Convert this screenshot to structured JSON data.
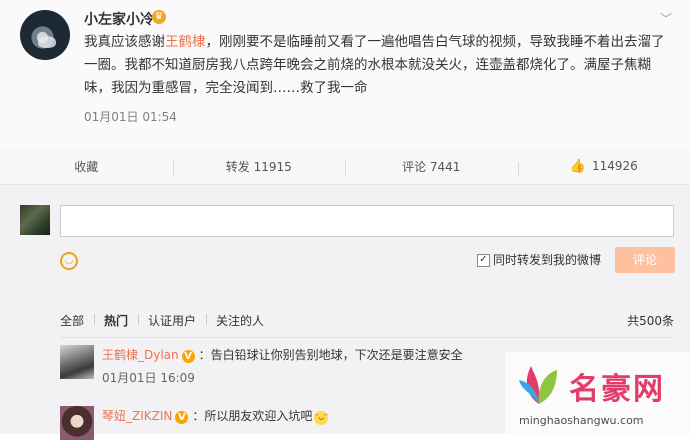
{
  "post": {
    "username": "小左家小冷",
    "text_before_mention": "我真应该感谢",
    "mention": "王鹤棣",
    "text_after_mention": "，刚刚要不是临睡前又看了一遍他唱告白气球的视频，导致我睡不着出去溜了一圈。我都不知道厨房我八点跨年晚会之前烧的水根本就没关火，连壶盖都烧化了。满屋子焦糊味，我因为重感冒，完全没闻到……救了我一命",
    "time": "01月01日 01:54"
  },
  "actions": {
    "favorite": "收藏",
    "repost": "转发 11915",
    "comment": "评论 7441",
    "like": "114926"
  },
  "composer": {
    "repost_label": "同时转发到我的微博",
    "submit": "评论"
  },
  "filters": {
    "tabs": [
      "全部",
      "热门",
      "认证用户",
      "关注的人"
    ],
    "count": "共500条"
  },
  "comments": [
    {
      "name": "王鹤棣_Dylan",
      "text": "：告白铅球让你别告别地球，下次还是要注意安全",
      "time": "01月01日 16:09"
    },
    {
      "name": "琴妞_ZIKZIN",
      "text": "：所以朋友欢迎入坑吧"
    }
  ],
  "watermark": {
    "title": "名豪网",
    "url": "minghaoshangwu.com"
  },
  "colors": {
    "accent": "#eb7350",
    "submit_disabled": "#ffc09f",
    "verified": "#f7a600"
  }
}
